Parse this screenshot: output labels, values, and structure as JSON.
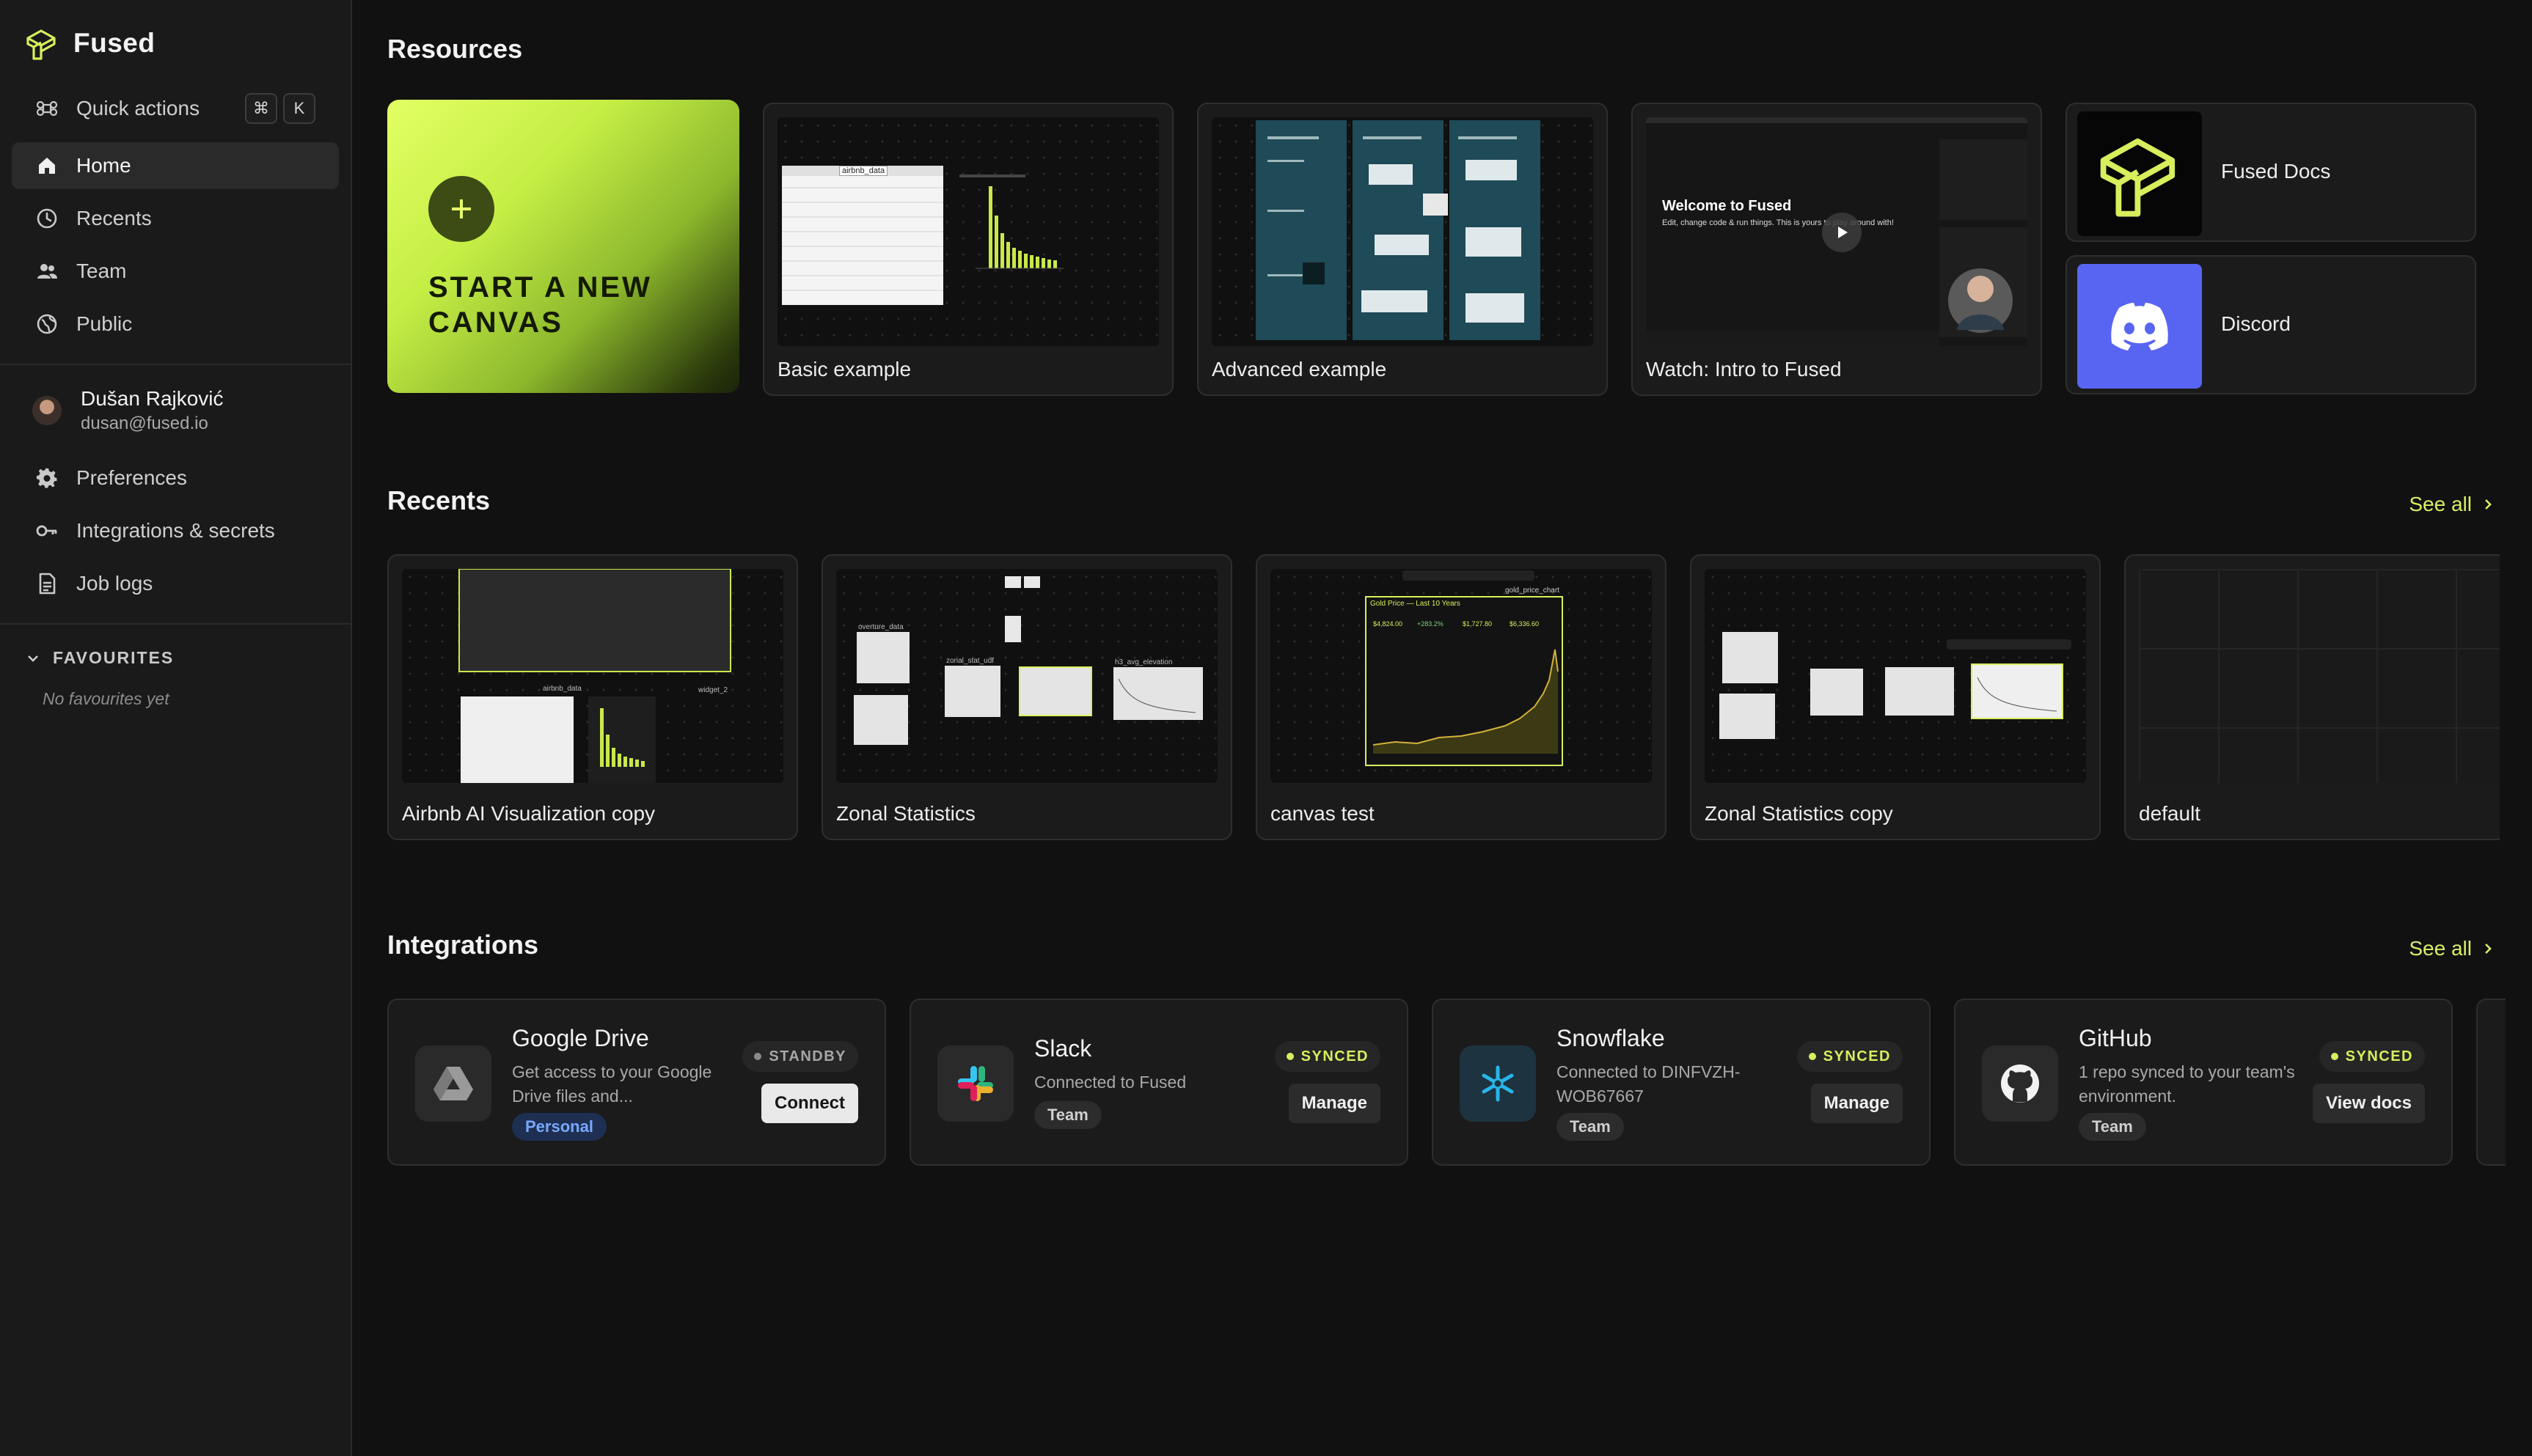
{
  "app": {
    "name": "Fused"
  },
  "sidebar": {
    "quick_actions": {
      "label": "Quick actions",
      "keys": [
        "⌘",
        "K"
      ]
    },
    "nav": [
      {
        "label": "Home",
        "icon": "home-icon",
        "active": true
      },
      {
        "label": "Recents",
        "icon": "clock-icon"
      },
      {
        "label": "Team",
        "icon": "team-icon"
      },
      {
        "label": "Public",
        "icon": "globe-icon"
      }
    ],
    "user": {
      "name": "Dušan Rajković",
      "email": "dusan@fused.io"
    },
    "settings": [
      {
        "label": "Preferences",
        "icon": "gear-icon"
      },
      {
        "label": "Integrations & secrets",
        "icon": "key-icon"
      },
      {
        "label": "Job logs",
        "icon": "document-icon"
      }
    ],
    "favourites": {
      "title": "FAVOURITES",
      "empty": "No favourites yet"
    }
  },
  "resources": {
    "title": "Resources",
    "new_canvas": "START A NEW CANVAS",
    "cards": [
      {
        "label": "Basic example",
        "thumb_texts": [
          "airbnb_data"
        ]
      },
      {
        "label": "Advanced example"
      },
      {
        "label": "Watch: Intro to Fused",
        "video_title": "Welcome to Fused",
        "video_sub": "Edit, change code & run things. This is yours to play around with!"
      }
    ],
    "links": [
      {
        "label": "Fused Docs",
        "icon": "fused-logo-icon"
      },
      {
        "label": "Discord",
        "icon": "discord-icon"
      }
    ]
  },
  "recents": {
    "title": "Recents",
    "see_all": "See all",
    "cards": [
      {
        "label": "Airbnb AI Visualization copy",
        "thumb_texts": [
          "airbnb_data",
          "widget_2"
        ]
      },
      {
        "label": "Zonal Statistics",
        "thumb_texts": [
          "zonal_stat_udf",
          "overture_data",
          "h3_avg_elevation"
        ]
      },
      {
        "label": "canvas test",
        "thumb_texts": [
          "gold_price_chart",
          "Gold Price — Last 10 Years",
          "$4,824.00",
          "+283.2%",
          "$1,727.80",
          "$6,336.60"
        ]
      },
      {
        "label": "Zonal Statistics copy"
      },
      {
        "label": "default"
      }
    ]
  },
  "integrations": {
    "title": "Integrations",
    "see_all": "See all",
    "items": [
      {
        "name": "Google Drive",
        "desc": "Get access to your Google Drive files and...",
        "tag": "Personal",
        "status": "STANDBY",
        "button": "Connect",
        "icon": "google-drive-icon"
      },
      {
        "name": "Slack",
        "desc": "Connected to Fused",
        "tag": "Team",
        "status": "SYNCED",
        "button": "Manage",
        "icon": "slack-icon"
      },
      {
        "name": "Snowflake",
        "desc": "Connected to DINFVZH-WOB67667",
        "tag": "Team",
        "status": "SYNCED",
        "button": "Manage",
        "icon": "snowflake-icon"
      },
      {
        "name": "GitHub",
        "desc": "1 repo synced to your team's environment.",
        "tag": "Team",
        "status": "SYNCED",
        "button": "View docs",
        "icon": "github-icon"
      }
    ]
  },
  "colors": {
    "accent": "#d8ee5d",
    "background": "#111111",
    "card": "#1b1b1b"
  }
}
